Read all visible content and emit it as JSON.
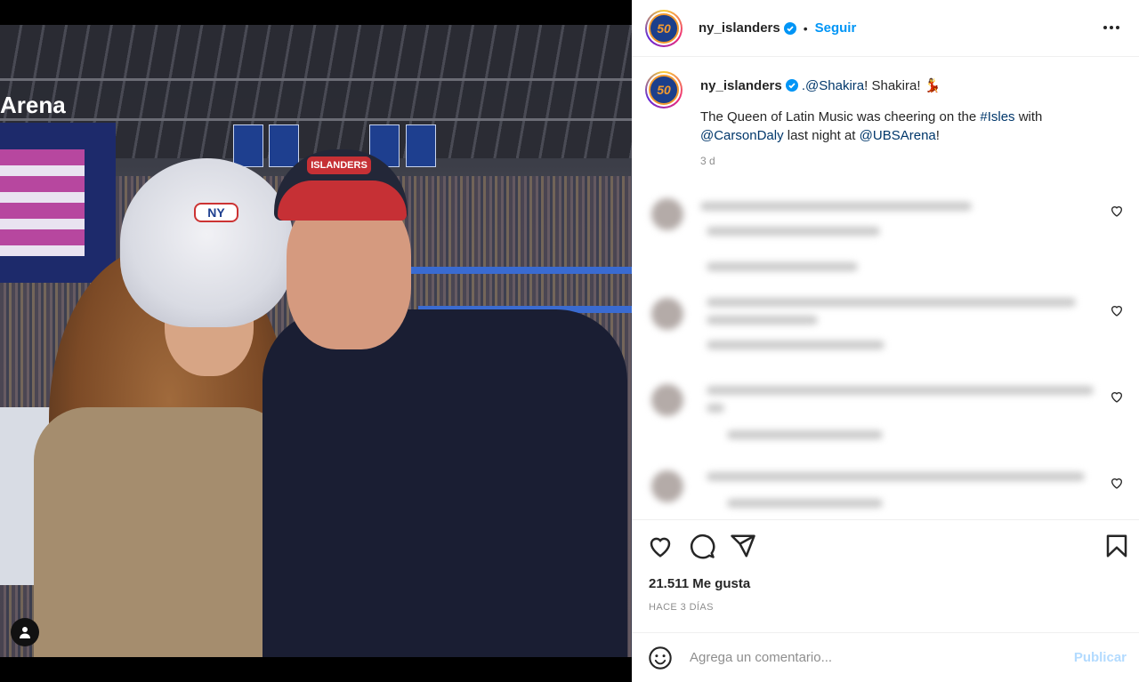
{
  "post": {
    "username": "ny_islanders",
    "avatar_text": "50",
    "follow_label": "Seguir",
    "separator": "•",
    "more_icon": "more-options-icon"
  },
  "photo": {
    "arena_text": "Arena",
    "hat_logo": "NY",
    "cap_logo": "ISLANDERS"
  },
  "caption": {
    "username": "ny_islanders",
    "mention_shakira": ".@Shakira",
    "text_part1": "! Shakira! ",
    "emoji": "💃",
    "line2_a": "The Queen of Latin Music was cheering on the ",
    "hashtag": "#Isles",
    "line2_b": " with",
    "mention_carson": "@CarsonDaly",
    "line3_a": " last night at ",
    "mention_ubs": "@UBSArena",
    "line3_b": "!",
    "time": "3 d"
  },
  "engagement": {
    "likes": "21.511 Me gusta",
    "ago": "HACE 3 DÍAS"
  },
  "composer": {
    "placeholder": "Agrega un comentario...",
    "publish_label": "Publicar"
  },
  "colors": {
    "accent": "#0095f6",
    "link": "#00376b",
    "publish_disabled": "#b3dbff"
  }
}
